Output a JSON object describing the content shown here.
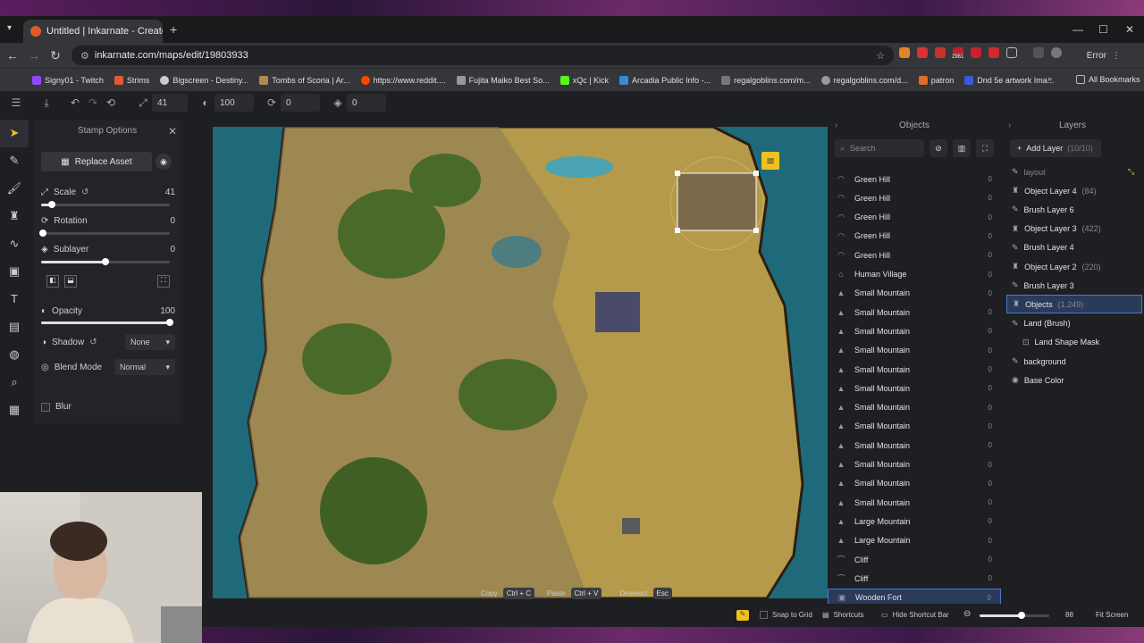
{
  "browser": {
    "tab_title": "Untitled | Inkarnate - Create Fa...",
    "url": "inkarnate.com/maps/edit/19803933",
    "error_label": "Error",
    "ext_badge": "2961",
    "bookmarks": [
      "Signy01 - Twitch",
      "Strims",
      "Bigscreen - Destiny...",
      "Tombs of Scoria | Ar...",
      "https://www.reddit....",
      "Fujita Maiko Best So...",
      "xQc | Kick",
      "Arcadia Public Info -...",
      "regalgoblins.com/m...",
      "regalgoblins.com/d...",
      "patron",
      "Dnd 5e artwork Ima..."
    ],
    "all_bookmarks": "All Bookmarks"
  },
  "toolbar": {
    "scale_value": "41",
    "opacity_value": "100",
    "rotation_value": "0",
    "layer_value": "0"
  },
  "stamp": {
    "title": "Stamp Options",
    "replace_label": "Replace Asset",
    "scale_label": "Scale",
    "scale_value": "41",
    "scale_pct": 41,
    "rotation_label": "Rotation",
    "rotation_value": "0",
    "sublayer_label": "Sublayer",
    "sublayer_value": "0",
    "sublayer_pct": 50,
    "opacity_label": "Opacity",
    "opacity_value": "100",
    "opacity_pct": 100,
    "shadow_label": "Shadow",
    "shadow_value": "None",
    "blend_label": "Blend Mode",
    "blend_value": "Normal",
    "blur_label": "Blur"
  },
  "objects": {
    "title": "Objects",
    "search_placeholder": "Search",
    "items": [
      {
        "label": "Green Hill",
        "count": "0"
      },
      {
        "label": "Green Hill",
        "count": "0"
      },
      {
        "label": "Green Hill",
        "count": "0"
      },
      {
        "label": "Green Hill",
        "count": "0"
      },
      {
        "label": "Green Hill",
        "count": "0"
      },
      {
        "label": "Human Village",
        "count": "0"
      },
      {
        "label": "Small Mountain",
        "count": "0"
      },
      {
        "label": "Small Mountain",
        "count": "0"
      },
      {
        "label": "Small Mountain",
        "count": "0"
      },
      {
        "label": "Small Mountain",
        "count": "0"
      },
      {
        "label": "Small Mountain",
        "count": "0"
      },
      {
        "label": "Small Mountain",
        "count": "0"
      },
      {
        "label": "Small Mountain",
        "count": "0"
      },
      {
        "label": "Small Mountain",
        "count": "0"
      },
      {
        "label": "Small Mountain",
        "count": "0"
      },
      {
        "label": "Small Mountain",
        "count": "0"
      },
      {
        "label": "Small Mountain",
        "count": "0"
      },
      {
        "label": "Small Mountain",
        "count": "0"
      },
      {
        "label": "Large Mountain",
        "count": "0"
      },
      {
        "label": "Large Mountain",
        "count": "0"
      },
      {
        "label": "Cliff",
        "count": "0"
      },
      {
        "label": "Cliff",
        "count": "0"
      },
      {
        "label": "Wooden Fort",
        "count": "0"
      }
    ]
  },
  "layers": {
    "title": "Layers",
    "add_label": "Add Layer",
    "add_count": "(10/10)",
    "items": [
      {
        "label": "layout",
        "count": ""
      },
      {
        "label": "Object Layer 4",
        "count": "(84)"
      },
      {
        "label": "Brush Layer 6",
        "count": ""
      },
      {
        "label": "Object Layer 3",
        "count": "(422)"
      },
      {
        "label": "Brush Layer 4",
        "count": ""
      },
      {
        "label": "Object Layer 2",
        "count": "(220)"
      },
      {
        "label": "Brush Layer 3",
        "count": ""
      },
      {
        "label": "Objects",
        "count": "(1,249)"
      },
      {
        "label": "Land (Brush)",
        "count": ""
      },
      {
        "label": "Land Shape Mask",
        "count": ""
      },
      {
        "label": "background",
        "count": ""
      },
      {
        "label": "Base Color",
        "count": ""
      }
    ]
  },
  "hints": {
    "copy": "Copy",
    "copy_key": "Ctrl + C",
    "paste": "Paste",
    "paste_key": "Ctrl + V",
    "deselect": "Deselect",
    "deselect_key": "Esc"
  },
  "status": {
    "snap": "Snap to Grid",
    "shortcuts": "Shortcuts",
    "hide": "Hide Shortcut Bar",
    "zoom": "88",
    "zoom_pct": 60,
    "fit": "Fit Screen"
  }
}
